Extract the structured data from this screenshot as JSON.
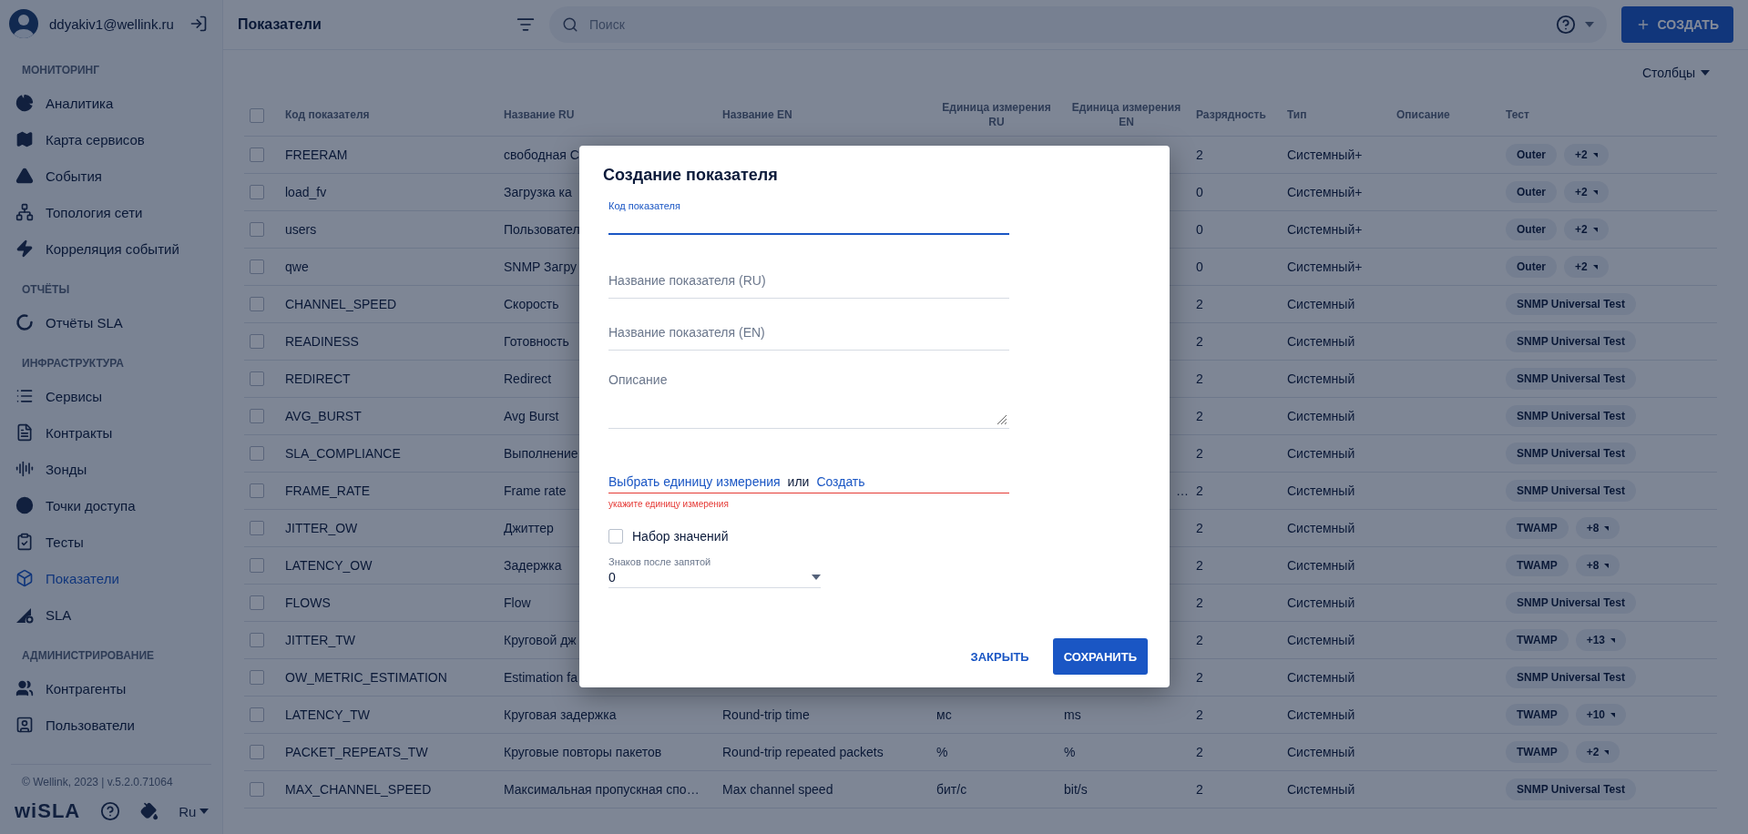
{
  "user": {
    "email": "ddyakiv1@wellink.ru"
  },
  "sidebar": {
    "sections": [
      {
        "title": "МОНИТОРИНГ",
        "items": [
          {
            "label": "Аналитика",
            "selected": false
          },
          {
            "label": "Карта сервисов",
            "selected": false
          },
          {
            "label": "События",
            "selected": false
          },
          {
            "label": "Топология сети",
            "selected": false
          },
          {
            "label": "Корреляция событий",
            "selected": false
          }
        ]
      },
      {
        "title": "ОТЧЁТЫ",
        "items": [
          {
            "label": "Отчёты SLA",
            "selected": false
          }
        ]
      },
      {
        "title": "ИНФРАСТРУКТУРА",
        "items": [
          {
            "label": "Сервисы",
            "selected": false
          },
          {
            "label": "Контракты",
            "selected": false
          },
          {
            "label": "Зонды",
            "selected": false
          },
          {
            "label": "Точки доступа",
            "selected": false
          },
          {
            "label": "Тесты",
            "selected": false
          },
          {
            "label": "Показатели",
            "selected": true
          },
          {
            "label": "SLA",
            "selected": false
          }
        ]
      },
      {
        "title": "АДМИНИСТРИРОВАНИЕ",
        "items": [
          {
            "label": "Контрагенты",
            "selected": false
          },
          {
            "label": "Пользователи",
            "selected": false
          }
        ]
      }
    ],
    "footer": "© Wellink, 2023 | v.5.2.0.71064",
    "logo": "wiSLA",
    "language": "Ru"
  },
  "page": {
    "title": "Показатели",
    "search": {
      "placeholder": "Поиск"
    },
    "create_button": "СОЗДАТЬ",
    "columns_button": "Столбцы"
  },
  "table": {
    "columns": [
      "Код показателя",
      "Название RU",
      "Название EN",
      "Единица измерения RU",
      "Единица измерения EN",
      "Разрядность",
      "Тип",
      "Описание",
      "Тест"
    ],
    "select_all_checked": false,
    "rows": [
      {
        "checked": false,
        "code": "FREERAM",
        "name_ru": "свободная С",
        "digits": "2",
        "type": "Системный+",
        "test": "Outer",
        "test_more": "+2"
      },
      {
        "checked": false,
        "code": "load_fv",
        "name_ru": "Загрузка ка",
        "digits": "0",
        "type": "Системный+",
        "test": "Outer",
        "test_more": "+2"
      },
      {
        "checked": false,
        "code": "users",
        "name_ru": "Пользовател",
        "digits": "0",
        "type": "Системный+",
        "test": "Outer",
        "test_more": "+2"
      },
      {
        "checked": false,
        "code": "qwe",
        "name_ru": "SNMP Загру",
        "digits": "0",
        "type": "Системный+",
        "test": "Outer",
        "test_more": "+2"
      },
      {
        "checked": false,
        "code": "CHANNEL_SPEED",
        "name_ru": "Скорость",
        "digits": "2",
        "type": "Системный",
        "test": "SNMP Universal Test"
      },
      {
        "checked": false,
        "code": "READINESS",
        "name_ru": "Готовность",
        "digits": "2",
        "type": "Системный",
        "test": "SNMP Universal Test"
      },
      {
        "checked": false,
        "code": "REDIRECT",
        "name_ru": "Redirect",
        "digits": "2",
        "type": "Системный",
        "test": "SNMP Universal Test"
      },
      {
        "checked": false,
        "code": "AVG_BURST",
        "name_ru": "Avg Burst",
        "digits": "2",
        "type": "Системный",
        "test": "SNMP Universal Test"
      },
      {
        "checked": false,
        "code": "SLA_COMPLIANCE",
        "name_ru": "Выполнение",
        "digits": "2",
        "type": "Системный",
        "test": "SNMP Universal Test"
      },
      {
        "checked": false,
        "code": "FRAME_RATE",
        "name_ru": "Frame rate",
        "unit_en": "…",
        "unit_en_cut": true,
        "digits": "2",
        "type": "Системный",
        "test": "SNMP Universal Test"
      },
      {
        "checked": false,
        "code": "JITTER_OW",
        "name_ru": "Джиттер",
        "digits": "2",
        "type": "Системный",
        "test": "TWAMP",
        "test_more": "+8"
      },
      {
        "checked": false,
        "code": "LATENCY_OW",
        "name_ru": "Задержка",
        "digits": "2",
        "type": "Системный",
        "test": "TWAMP",
        "test_more": "+8"
      },
      {
        "checked": false,
        "code": "FLOWS",
        "name_ru": "Flow",
        "digits": "2",
        "type": "Системный",
        "test": "SNMP Universal Test"
      },
      {
        "checked": false,
        "code": "JITTER_TW",
        "name_ru": "Круговой дж",
        "digits": "2",
        "type": "Системный",
        "test": "TWAMP",
        "test_more": "+13"
      },
      {
        "checked": false,
        "code": "OW_METRIC_ESTIMATION",
        "name_ru": "Estimation fa",
        "digits": "2",
        "type": "Системный",
        "test": "SNMP Universal Test"
      },
      {
        "checked": false,
        "code": "LATENCY_TW",
        "name_ru": "Круговая задержка",
        "name_en": "Round-trip time",
        "unit_ru": "мс",
        "unit_en": "ms",
        "digits": "2",
        "type": "Системный",
        "test": "TWAMP",
        "test_more": "+10"
      },
      {
        "checked": false,
        "code": "PACKET_REPEATS_TW",
        "name_ru": "Круговые повторы пакетов",
        "name_en": "Round-trip repeated packets",
        "unit_ru": "%",
        "unit_en": "%",
        "digits": "2",
        "type": "Системный",
        "test": "TWAMP",
        "test_more": "+2"
      },
      {
        "checked": false,
        "code": "MAX_CHANNEL_SPEED",
        "name_ru": "Максимальная пропускная спо…",
        "name_en": "Max channel speed",
        "unit_ru": "бит/с",
        "unit_en": "bit/s",
        "digits": "2",
        "type": "Системный",
        "test": "SNMP Universal Test"
      }
    ]
  },
  "dialog": {
    "title": "Создание показателя",
    "fields": [
      {
        "kind": "text",
        "label": "Код показателя",
        "focused": true
      },
      {
        "kind": "text",
        "placeholder": "Название показателя (RU)",
        "focused": false
      },
      {
        "kind": "text",
        "placeholder": "Название показателя (EN)",
        "focused": false
      },
      {
        "kind": "textarea",
        "placeholder": "Описание",
        "focused": false
      }
    ],
    "unit": {
      "select_link": "Выбрать единицу измерения",
      "or": "или",
      "create_link": "Создать",
      "error": "укажите единицу измерения"
    },
    "value_set": {
      "label": "Набор значений",
      "checked": false
    },
    "decimals": {
      "label": "Знаков после запятой",
      "value": "0"
    },
    "buttons": {
      "close": "ЗАКРЫТЬ",
      "save": "СОХРАНИТЬ"
    }
  }
}
